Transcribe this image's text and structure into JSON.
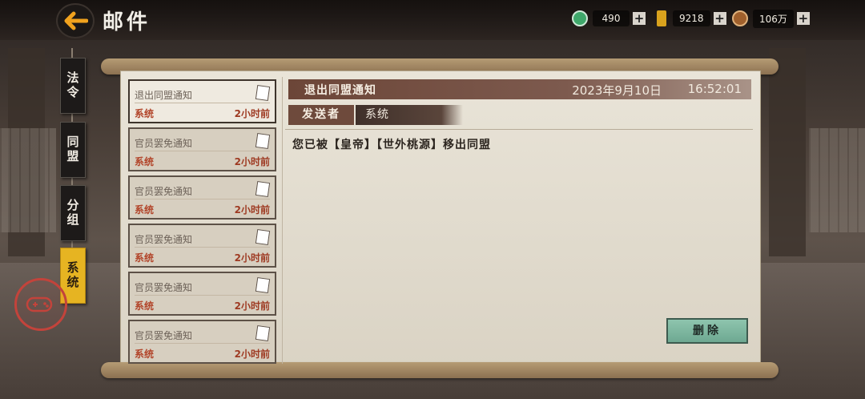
{
  "header": {
    "title": "邮件"
  },
  "resources": [
    {
      "icon": "jade-coin-icon",
      "value": "490",
      "color": "#3fa86b"
    },
    {
      "icon": "gold-token-icon",
      "value": "9218",
      "color": "#d9a21d"
    },
    {
      "icon": "copper-coin-icon",
      "value": "106万",
      "color": "#a0602c"
    }
  ],
  "tabs": [
    {
      "label": "法令"
    },
    {
      "label": "同盟"
    },
    {
      "label": "分组"
    },
    {
      "label": "系统"
    }
  ],
  "mail_list": [
    {
      "subject": "退出同盟通知",
      "sender": "系统",
      "time": "2小时前"
    },
    {
      "subject": "官员罢免通知",
      "sender": "系统",
      "time": "2小时前"
    },
    {
      "subject": "官员罢免通知",
      "sender": "系统",
      "time": "2小时前"
    },
    {
      "subject": "官员罢免通知",
      "sender": "系统",
      "time": "2小时前"
    },
    {
      "subject": "官员罢免通知",
      "sender": "系统",
      "time": "2小时前"
    },
    {
      "subject": "官员罢免通知",
      "sender": "系统",
      "time": "2小时前"
    }
  ],
  "detail": {
    "title": "退出同盟通知",
    "date": "2023年9月10日",
    "time": "16:52:01",
    "sender_label": "发送者",
    "sender": "系统",
    "body": "您已被【皇帝】【世外桃源】移出同盟"
  },
  "actions": {
    "delete_label": "删除"
  },
  "colors": {
    "active_tab": "#e6b422",
    "header_bar": "#6c4638",
    "delete_button": "#8ec5ae",
    "sender_red": "#b2452a"
  }
}
